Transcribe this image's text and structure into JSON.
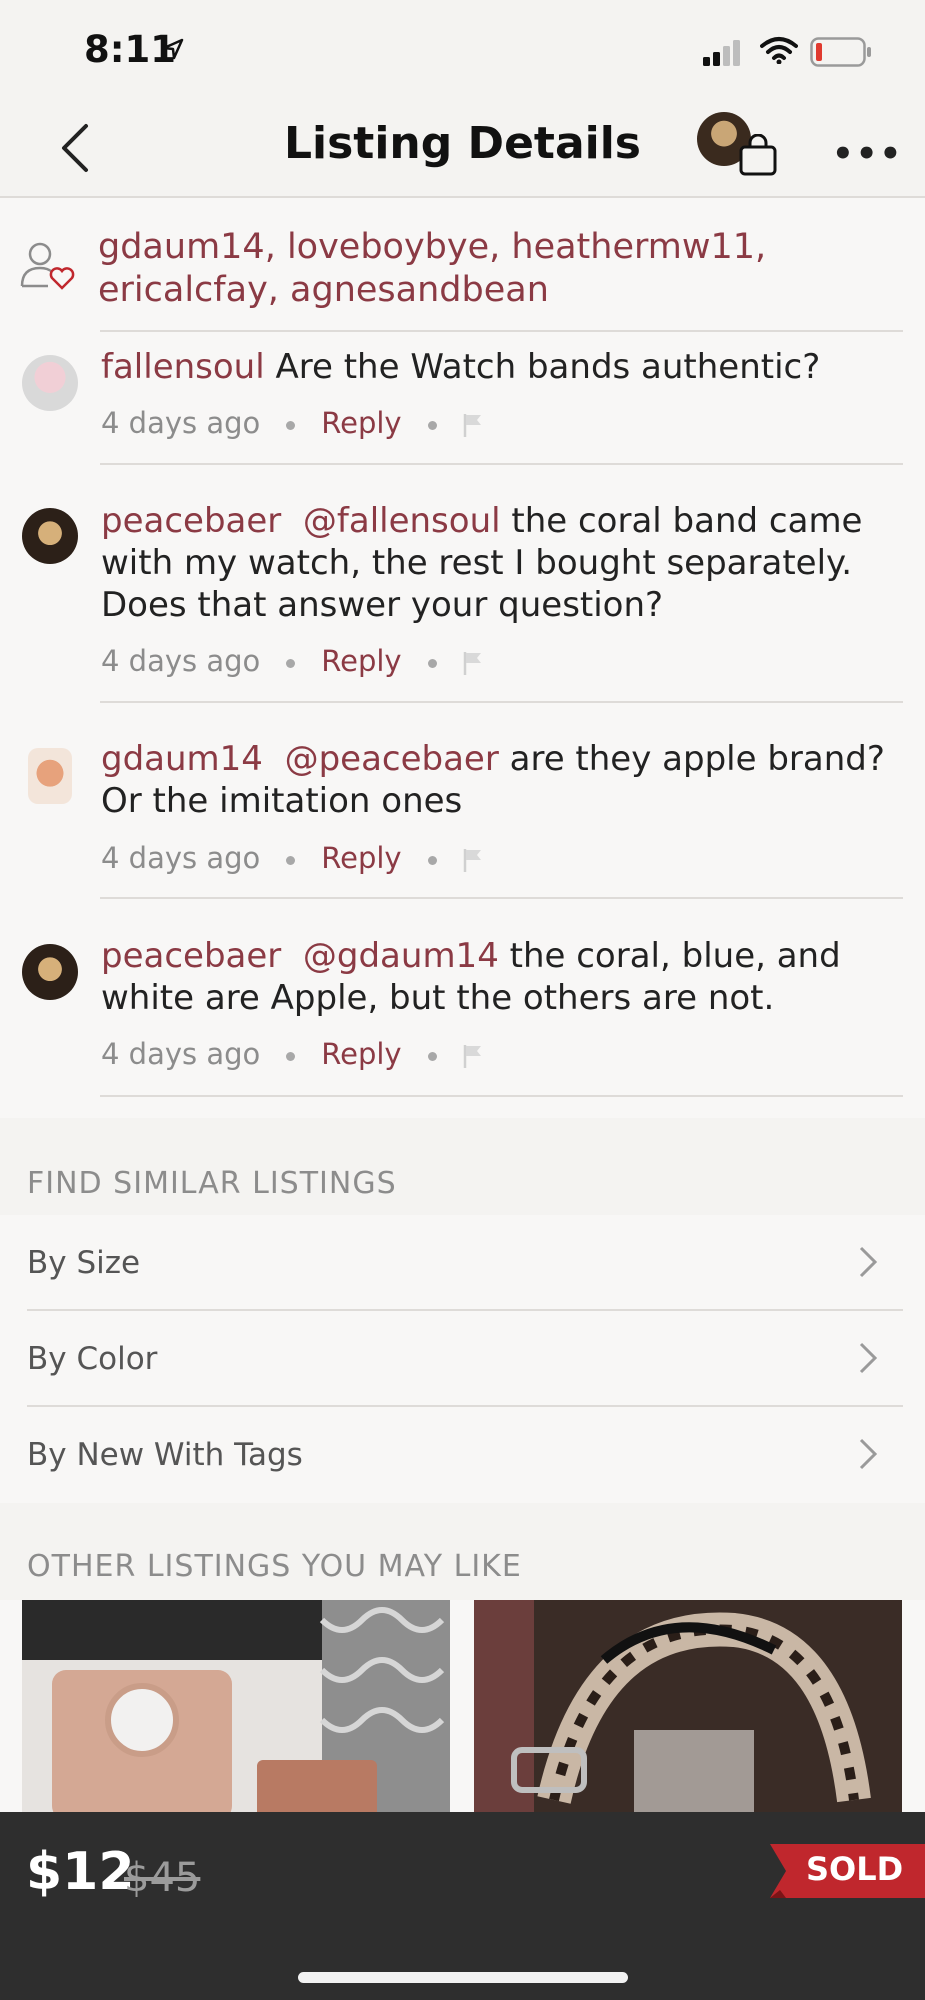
{
  "status": {
    "time": "8:11"
  },
  "header": {
    "title": "Listing Details"
  },
  "likes": {
    "users": "gdaum14, loveboybye, heathermw11, ericalcfay, agnesandbean"
  },
  "comments": [
    {
      "user": "fallensoul",
      "mention": "",
      "text": " Are the  Watch bands authentic?",
      "time": "4 days ago",
      "reply": "Reply"
    },
    {
      "user": "peacebaer",
      "mention": "@fallensoul",
      "text": " the coral band came with my watch, the rest I bought separately. Does that answer your question?",
      "time": "4 days ago",
      "reply": "Reply"
    },
    {
      "user": "gdaum14",
      "mention": "@peacebaer",
      "text": " are they apple brand? Or the imitation ones",
      "time": "4 days ago",
      "reply": "Reply"
    },
    {
      "user": "peacebaer",
      "mention": "@gdaum14",
      "text": " the coral, blue, and white are Apple, but the others are not.",
      "time": "4 days ago",
      "reply": "Reply"
    }
  ],
  "similar": {
    "heading": "FIND SIMILAR LISTINGS",
    "items": [
      {
        "label": "By Size"
      },
      {
        "label": "By Color"
      },
      {
        "label": "By New With Tags"
      }
    ]
  },
  "other": {
    "heading": "OTHER LISTINGS YOU MAY LIKE"
  },
  "bottom": {
    "price": "$12",
    "original_price": "$45",
    "status": "SOLD"
  },
  "colors": {
    "accent": "#8b3a44",
    "sold": "#c0272d",
    "bar": "#2e2e2e"
  }
}
